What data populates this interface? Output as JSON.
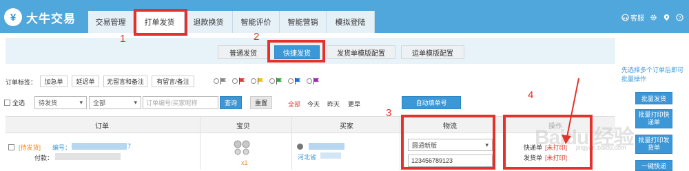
{
  "app": {
    "logo_text": "大牛交易",
    "logo_mark": "¥"
  },
  "tabs": [
    {
      "label": "交易管理"
    },
    {
      "label": "打单发货"
    },
    {
      "label": "退款换货"
    },
    {
      "label": "智能评价"
    },
    {
      "label": "智能营销"
    },
    {
      "label": "模拟登陆"
    }
  ],
  "header_right": {
    "service": "客服"
  },
  "subnav": [
    {
      "label": "普通发货"
    },
    {
      "label": "快捷发货"
    },
    {
      "label": "发货单模版配置"
    },
    {
      "label": "运单模版配置"
    }
  ],
  "hint_text": "先选择多个订单后即可批量操作",
  "tags": {
    "label": "订单标签：",
    "items": [
      "加急单",
      "延迟单",
      "无留言和备注",
      "有留言/备注"
    ],
    "flag_colors": [
      "#888888",
      "#e53935",
      "#f4c20d",
      "#2eaa3f",
      "#1e6fd9",
      "#9c27b0"
    ]
  },
  "filters": {
    "select_all": "全选",
    "status_value": "待发货",
    "all_value": "全部",
    "search_placeholder": "订单编号/买家昵称",
    "query": "查询",
    "reset": "重置",
    "time_links": [
      "全部",
      "今天",
      "昨天",
      "更早"
    ],
    "auto_fill": "自动填单号"
  },
  "table": {
    "headers": [
      "订单",
      "宝贝",
      "买家",
      "物流",
      "操作"
    ],
    "row": {
      "status": "[待发货]",
      "order_no_label": "编号：",
      "order_no_tail": "7",
      "payment_label": "付款：",
      "qty": "x1",
      "buyer_region": "河北省",
      "carrier": "圆通新版",
      "tracking": "123456789123",
      "express_label": "快递单",
      "express_status": "[未打印]",
      "invoice_label": "发货单",
      "invoice_status": "[未打印]"
    }
  },
  "side_buttons": [
    "批量发货",
    "批量打印快递单",
    "批量打印发货单",
    "一键快递"
  ],
  "annotations": [
    "1",
    "2",
    "3",
    "4"
  ],
  "watermark": "Baidu 经验",
  "watermark_url": "jingyan.baidu.com",
  "colors": {
    "header": "#4fa7dc",
    "accent": "#3c97d6",
    "annotation": "#e5302b",
    "status": "#f08a24"
  }
}
